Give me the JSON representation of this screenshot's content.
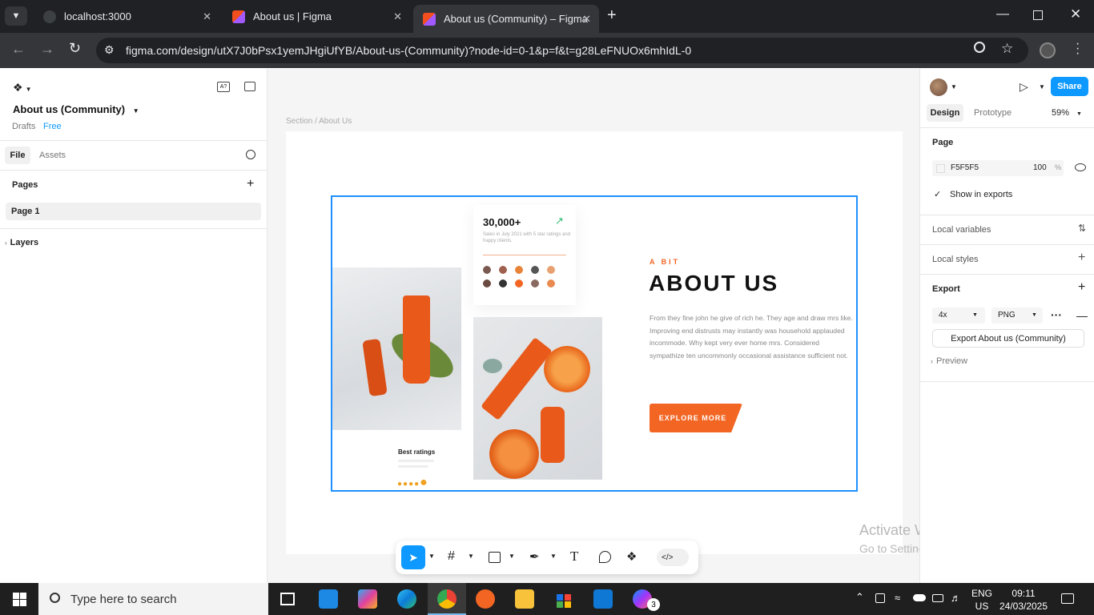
{
  "browser": {
    "tabs": [
      {
        "title": "localhost:3000",
        "active": false
      },
      {
        "title": "About us | Figma",
        "active": false
      },
      {
        "title": "About us (Community) – Figma",
        "active": true
      }
    ],
    "url": "figma.com/design/utX7J0bPsx1yemJHgiUfYB/About-us-(Community)?node-id=0-1&p=f&t=g28LeFNUOx6mhIdL-0"
  },
  "left": {
    "file_name": "About us (Community)",
    "drafts": "Drafts",
    "plan": "Free",
    "tab_file": "File",
    "tab_assets": "Assets",
    "pages_label": "Pages",
    "page_item": "Page 1",
    "layers_label": "Layers"
  },
  "canvas": {
    "section_label": "Section / About Us",
    "design": {
      "stat_value": "30,000+",
      "stat_desc": "Sales in July 2021 with 5 star ratings and happy clients.",
      "ratings_label": "Best ratings",
      "eyebrow": "A BIT",
      "heading": "ABOUT US",
      "body": "From they fine john he give of rich he. They age and draw mrs like. Improving end distrusts may instantly was household applauded incommode. Why kept very ever home mrs. Considered sympathize ten uncommonly occasional assistance sufficient not.",
      "cta": "EXPLORE MORE",
      "brand_color": "#f26522"
    },
    "watermark_title": "Activate Windows",
    "watermark_sub": "Go to Settings to activate Windows.",
    "help": "?"
  },
  "right": {
    "share": "Share",
    "tab_design": "Design",
    "tab_prototype": "Prototype",
    "zoom": "59%",
    "page_label": "Page",
    "page_color": "F5F5F5",
    "page_opacity": "100",
    "percent": "%",
    "show_exports": "Show in exports",
    "local_variables": "Local variables",
    "local_styles": "Local styles",
    "export_label": "Export",
    "export_scale": "4x",
    "export_format": "PNG",
    "export_button": "Export About us (Community)",
    "preview": "Preview"
  },
  "taskbar": {
    "search_placeholder": "Type here to search",
    "lang_top": "ENG",
    "lang_bottom": "US",
    "time": "09:11",
    "date": "24/03/2025",
    "badge": "3"
  }
}
